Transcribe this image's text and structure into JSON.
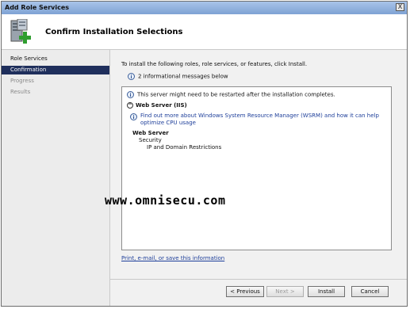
{
  "window": {
    "title": "Add Role Services",
    "close_glyph": "X"
  },
  "header": {
    "title": "Confirm Installation Selections",
    "icon": "server-add-icon"
  },
  "sidebar": {
    "items": [
      {
        "label": "Role Services",
        "state": "normal"
      },
      {
        "label": "Confirmation",
        "state": "active"
      },
      {
        "label": "Progress",
        "state": "disabled"
      },
      {
        "label": "Results",
        "state": "disabled"
      }
    ]
  },
  "main": {
    "intro": "To install the following roles, role services, or features, click Install.",
    "info_count": "2 informational messages below",
    "restart_note": "This server might need to be restarted after the installation completes.",
    "section_title": "Web Server (IIS)",
    "wsrm_link": "Find out more about Windows System Resource Manager (WSRM) and how it can help optimize CPU usage",
    "role_heading": "Web Server",
    "role_sub": "Security",
    "role_item": "IP and Domain Restrictions",
    "print_link": "Print, e-mail, or save this information"
  },
  "watermark": "www.omnisecu.com",
  "buttons": {
    "previous": "< Previous",
    "next": "Next >",
    "install": "Install",
    "cancel": "Cancel"
  },
  "colors": {
    "active_nav": "#1f2f5c",
    "link": "#1e3f9a"
  }
}
